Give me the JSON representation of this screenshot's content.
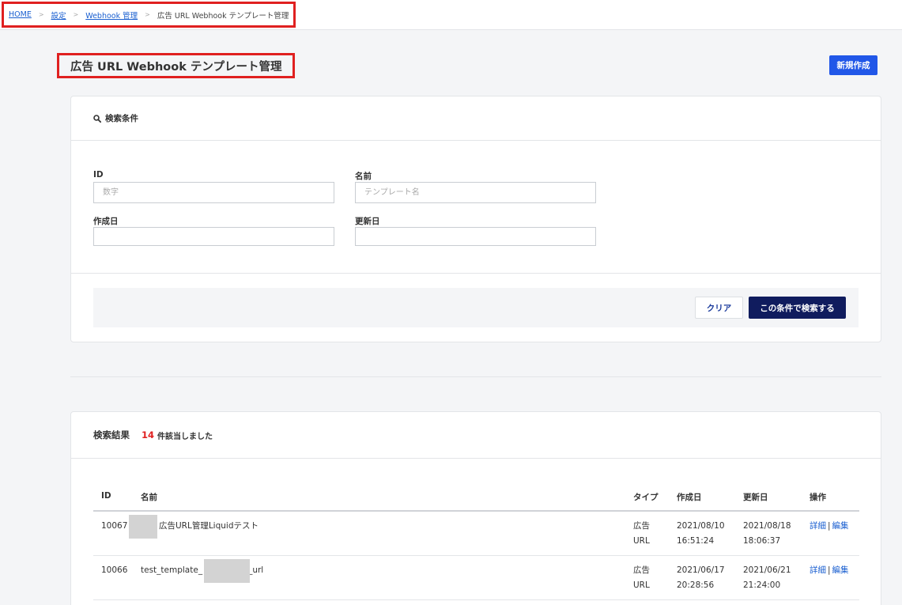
{
  "breadcrumb": {
    "home": "HOME",
    "settings": "設定",
    "webhook": "Webhook 管理",
    "current": "広告 URL Webhook テンプレート管理",
    "separator": ">"
  },
  "page": {
    "title": "広告 URL Webhook テンプレート管理",
    "new_button": "新規作成"
  },
  "search": {
    "heading": "検索条件",
    "id_label": "ID",
    "id_placeholder": "数字",
    "name_label": "名前",
    "name_placeholder": "テンプレート名",
    "created_label": "作成日",
    "updated_label": "更新日",
    "clear_button": "クリア",
    "search_button": "この条件で検索する"
  },
  "results": {
    "title": "検索結果",
    "count": "14",
    "count_suffix": "件該当しました",
    "columns": {
      "id": "ID",
      "name": "名前",
      "type": "タイプ",
      "created": "作成日",
      "updated": "更新日",
      "ops": "操作"
    },
    "rows": [
      {
        "id": "10067",
        "name": "広告URL管理Liquidテスト",
        "type": "広告 URL",
        "created_date": "2021/08/10",
        "created_time": "16:51:24",
        "updated_date": "2021/08/18",
        "updated_time": "18:06:37",
        "detail": "詳細",
        "edit": "編集"
      },
      {
        "id": "10066",
        "name_prefix": "test_template_",
        "name_suffix": "_url",
        "type": "広告 URL",
        "created_date": "2021/06/17",
        "created_time": "20:28:56",
        "updated_date": "2021/06/21",
        "updated_time": "21:24:00",
        "detail": "詳細",
        "edit": "編集"
      }
    ],
    "ops_separator": "|"
  }
}
